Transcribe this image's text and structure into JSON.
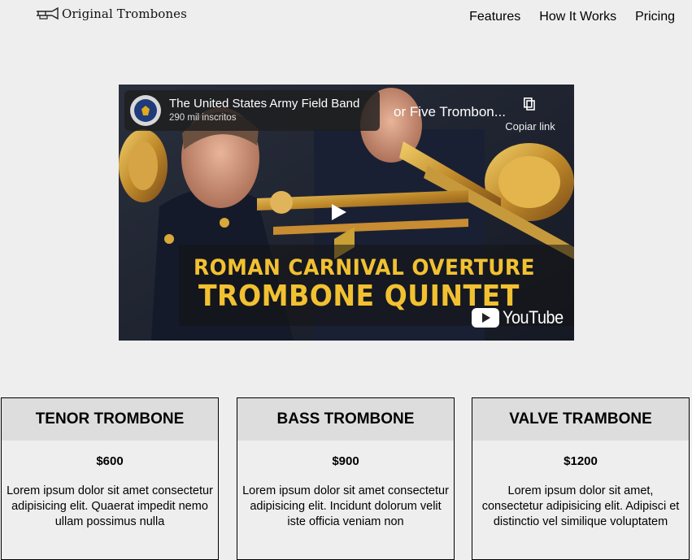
{
  "header": {
    "logo_text": "Original Trombones",
    "nav": [
      {
        "label": "Features"
      },
      {
        "label": "How It Works"
      },
      {
        "label": "Pricing"
      }
    ]
  },
  "video": {
    "channel_name": "The United States Army Field Band",
    "channel_subs": "290 mil inscritos",
    "title": "Roman Carnival Overture Op. 9 for Five Trombon...",
    "copy_label": "Copiar link",
    "overlay_line1": "ROMAN CARNIVAL OVERTURE",
    "overlay_line2": "TROMBONE QUINTET",
    "platform_logo": "YouTube"
  },
  "pricing": [
    {
      "name": "TENOR TROMBONE",
      "price": "$600",
      "description": "Lorem ipsum dolor sit amet consectetur adipisicing elit. Quaerat impedit nemo ullam possimus nulla"
    },
    {
      "name": "BASS TROMBONE",
      "price": "$900",
      "description": "Lorem ipsum dolor sit amet consectetur adipisicing elit. Incidunt dolorum velit iste officia veniam non"
    },
    {
      "name": "VALVE TRAMBONE",
      "price": "$1200",
      "description": "Lorem ipsum dolor sit amet, consectetur adipisicing elit. Adipisci et distinctio vel similique voluptatem"
    }
  ],
  "colors": {
    "page_bg": "#eeeeee",
    "card_header_bg": "#dddddd",
    "overlay_text": "#f2c131"
  },
  "icons": {
    "logo": "trombone-icon",
    "copy": "copy-link-icon",
    "play": "play-icon"
  }
}
